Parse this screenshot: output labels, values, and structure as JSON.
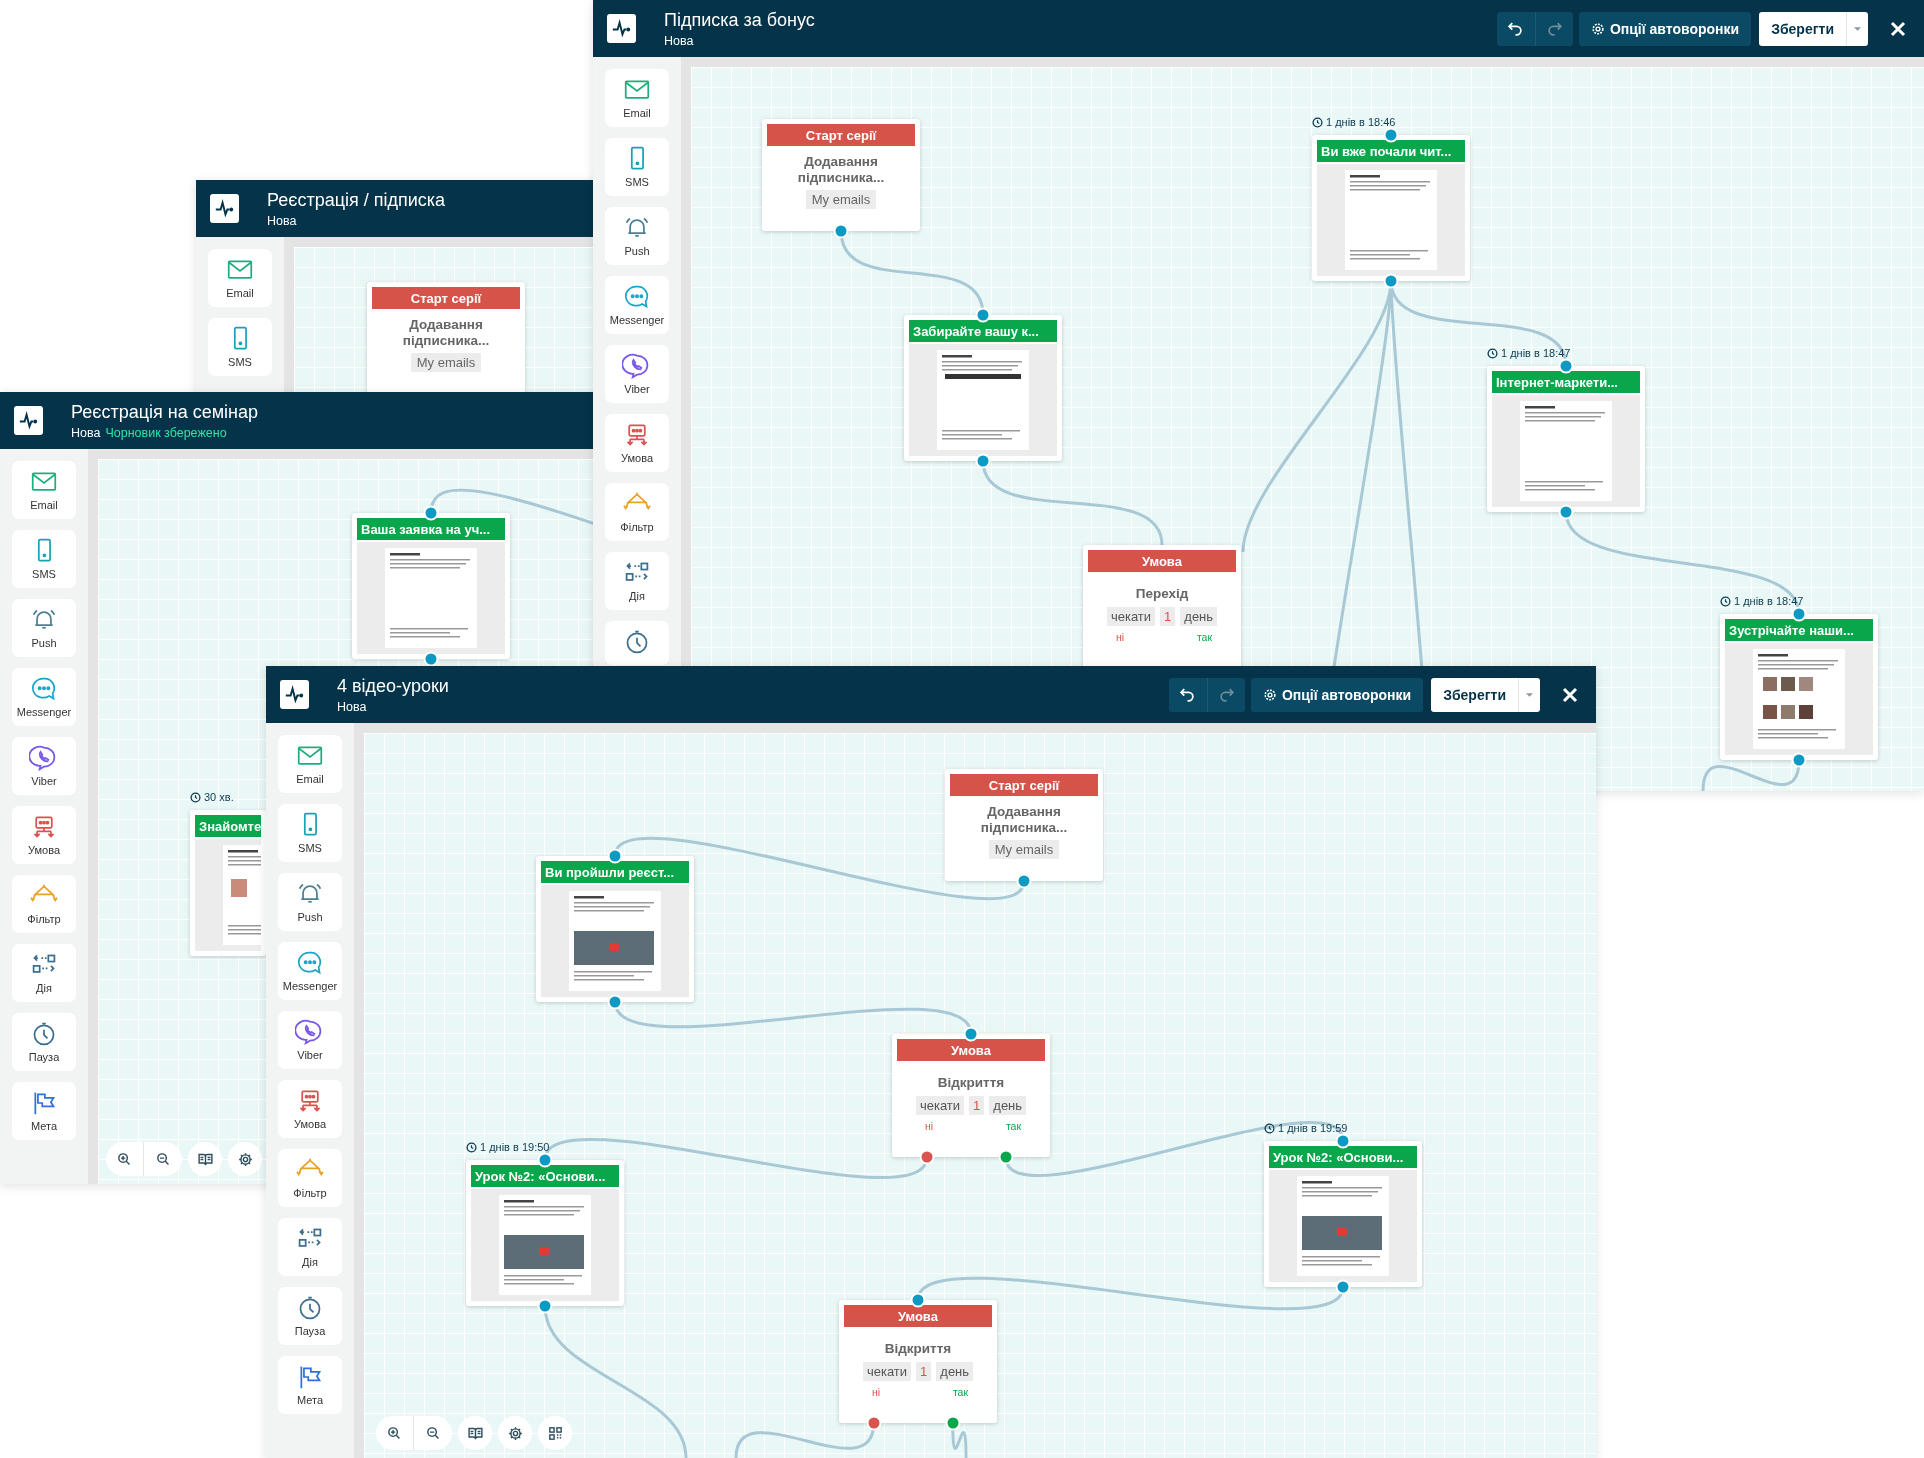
{
  "windows": [
    {
      "title": "Підписка за бонус",
      "subtitle": "Нова",
      "toolbar": {
        "history": [
          {
            "kind": "undo",
            "disabled": false
          },
          {
            "kind": "redo",
            "disabled": true
          }
        ],
        "options": "Опції автоворонки",
        "save": "Зберегти"
      },
      "tools": [
        {
          "kind": "email",
          "label": "Email"
        },
        {
          "kind": "sms",
          "label": "SMS"
        },
        {
          "kind": "push",
          "label": "Push"
        },
        {
          "kind": "messenger",
          "label": "Messenger"
        },
        {
          "kind": "viber",
          "label": "Viber"
        },
        {
          "kind": "condition",
          "label": "Умова"
        },
        {
          "kind": "filter",
          "label": "Фільтр"
        },
        {
          "kind": "action",
          "label": "Дія"
        },
        {
          "kind": "pause"
        }
      ],
      "nodes": [
        {
          "kind": "start",
          "header": "Старт серії",
          "title": "Додавання підписника...",
          "tag": "My emails"
        },
        {
          "kind": "email",
          "timing": "1 днів в 18:46",
          "title": "Ви вже почали чит..."
        },
        {
          "kind": "email",
          "title": "Забирайте вашу к..."
        },
        {
          "kind": "email",
          "timing": "1 днів в 18:47",
          "title": "Інтернет-маркети..."
        },
        {
          "kind": "condition",
          "header": "Умова",
          "title": "Перехід",
          "wait": "чекати",
          "value": "1",
          "unit": "день",
          "no": "ні",
          "yes": "так"
        },
        {
          "kind": "email",
          "timing": "1 днів в 18:47",
          "title": "Зустрічайте наши..."
        }
      ]
    },
    {
      "title": "Реєстрація / підписка",
      "subtitle": "Нова",
      "tools": [
        {
          "kind": "email",
          "label": "Email"
        },
        {
          "kind": "sms",
          "label": "SMS"
        }
      ],
      "nodes": [
        {
          "kind": "start",
          "header": "Старт серії",
          "title": "Додавання підписника...",
          "tag": "My emails"
        }
      ]
    },
    {
      "title": "Реєстрація на семінар",
      "subtitle": "Нова",
      "status": "Чорновик збережено",
      "tools": [
        {
          "kind": "email",
          "label": "Email"
        },
        {
          "kind": "sms",
          "label": "SMS"
        },
        {
          "kind": "push",
          "label": "Push"
        },
        {
          "kind": "messenger",
          "label": "Messenger"
        },
        {
          "kind": "viber",
          "label": "Viber"
        },
        {
          "kind": "condition",
          "label": "Умова"
        },
        {
          "kind": "filter",
          "label": "Фільтр"
        },
        {
          "kind": "action",
          "label": "Дія"
        },
        {
          "kind": "pause",
          "label": "Пауза"
        },
        {
          "kind": "goal",
          "label": "Мета"
        }
      ],
      "nodes": [
        {
          "kind": "email",
          "title": "Ваша заявка на уч..."
        },
        {
          "kind": "email",
          "timing": "30 хв.",
          "title": "Знайомте"
        }
      ],
      "controls": [
        {
          "kind": "zoom-in"
        },
        {
          "kind": "zoom-out"
        },
        {
          "kind": "guide"
        },
        {
          "kind": "settings"
        }
      ]
    },
    {
      "title": "4 відео-уроки",
      "subtitle": "Нова",
      "toolbar": {
        "history": [
          {
            "kind": "undo",
            "disabled": false
          },
          {
            "kind": "redo",
            "disabled": true
          }
        ],
        "options": "Опції автоворонки",
        "save": "Зберегти"
      },
      "tools": [
        {
          "kind": "email",
          "label": "Email"
        },
        {
          "kind": "sms",
          "label": "SMS"
        },
        {
          "kind": "push",
          "label": "Push"
        },
        {
          "kind": "messenger",
          "label": "Messenger"
        },
        {
          "kind": "viber",
          "label": "Viber"
        },
        {
          "kind": "condition",
          "label": "Умова"
        },
        {
          "kind": "filter",
          "label": "Фільтр"
        },
        {
          "kind": "action",
          "label": "Дія"
        },
        {
          "kind": "pause",
          "label": "Пауза"
        },
        {
          "kind": "goal",
          "label": "Мета"
        }
      ],
      "nodes": [
        {
          "kind": "start",
          "header": "Старт серії",
          "title": "Додавання підписника...",
          "tag": "My emails"
        },
        {
          "kind": "email",
          "title": "Ви пройшли реєст..."
        },
        {
          "kind": "condition",
          "header": "Умова",
          "title": "Відкриття",
          "wait": "чекати",
          "value": "1",
          "unit": "день",
          "no": "ні",
          "yes": "так"
        },
        {
          "kind": "email",
          "timing": "1 днів в 19:59",
          "title": "Урок №2: «Основи..."
        },
        {
          "kind": "email",
          "timing": "1 днів в 19:50",
          "title": "Урок №2: «Основи..."
        },
        {
          "kind": "condition",
          "header": "Умова",
          "title": "Відкриття",
          "wait": "чекати",
          "value": "1",
          "unit": "день",
          "no": "ні",
          "yes": "так"
        }
      ],
      "controls": [
        {
          "kind": "zoom-in"
        },
        {
          "kind": "zoom-out"
        },
        {
          "kind": "guide"
        },
        {
          "kind": "settings"
        },
        {
          "kind": "layout"
        }
      ]
    }
  ]
}
